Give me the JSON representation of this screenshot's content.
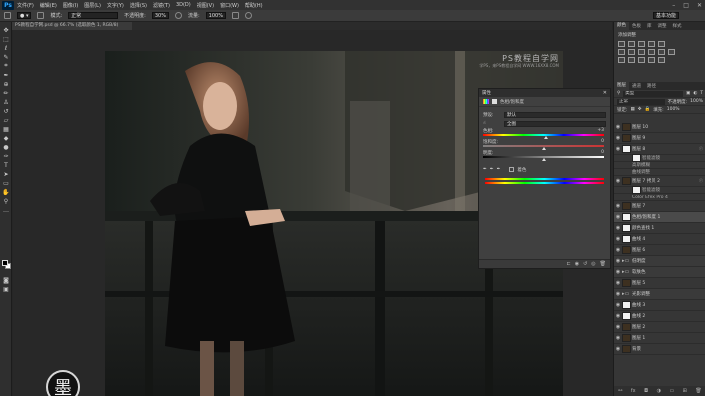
{
  "app": {
    "logo": "Ps",
    "menu": [
      "文件(F)",
      "编辑(E)",
      "图像(I)",
      "图层(L)",
      "文字(Y)",
      "选择(S)",
      "滤镜(T)",
      "3D(D)",
      "视图(V)",
      "窗口(W)",
      "帮助(H)"
    ],
    "window_controls": [
      "–",
      "□",
      "✕"
    ]
  },
  "options_bar": {
    "mode_label": "模式:",
    "mode_value": "正常",
    "opacity_label": "不透明度:",
    "opacity_value": "30%",
    "flow_label": "流量:",
    "flow_value": "100%",
    "workspace": "基本功能"
  },
  "document": {
    "tab_label": "PS教程自学网.psd @ 66.7% (选取颜色 1, RGB/8)"
  },
  "watermark": {
    "title": "PS教程自学网",
    "subtitle": "学PS，来PS教程自学网  WWW.16XX8.COM",
    "seal_char": "墨"
  },
  "properties": {
    "panel_tab": "属性",
    "close": "✕",
    "title": "色相/饱和度",
    "preset_label": "预设:",
    "preset_value": "默认",
    "channel_value": "全图",
    "sliders": [
      {
        "label": "色相:",
        "value": "+3",
        "fraction": 0.52
      },
      {
        "label": "饱和度:",
        "value": "0",
        "fraction": 0.5
      },
      {
        "label": "明度:",
        "value": "0",
        "fraction": 0.5
      }
    ],
    "colorize_label": "着色"
  },
  "right_panels": {
    "top_tabs": [
      "颜色",
      "色板",
      "库",
      "调整",
      "样式"
    ],
    "adjust_title": "添加调整",
    "layer_tabs": [
      "图层",
      "通道",
      "路径"
    ],
    "kind_label": "类型",
    "blend_mode": "正常",
    "opacity_label": "不透明度:",
    "opacity_value": "100%",
    "lock_label": "锁定:",
    "fill_label": "填充:",
    "fill_value": "100%",
    "layers": [
      {
        "name": "图层 10",
        "thumb": "photo",
        "visible": true,
        "type": "normal"
      },
      {
        "name": "图层 9",
        "thumb": "photo",
        "visible": true,
        "type": "normal"
      },
      {
        "name": "图层 8",
        "thumb": "white",
        "visible": true,
        "type": "normal",
        "fx": true
      },
      {
        "name": "智能滤镜",
        "thumb": "white",
        "visible": true,
        "type": "effect"
      },
      {
        "name": "高斯模糊",
        "thumb": "",
        "visible": true,
        "type": "effect"
      },
      {
        "name": "曲线调整",
        "thumb": "",
        "visible": true,
        "type": "effect"
      },
      {
        "name": "图层 7 拷贝 2",
        "thumb": "photo",
        "visible": true,
        "type": "normal",
        "fx": true
      },
      {
        "name": "智能滤镜",
        "thumb": "white",
        "visible": true,
        "type": "effect"
      },
      {
        "name": "Color Efex Pro 4",
        "thumb": "",
        "visible": true,
        "type": "effect"
      },
      {
        "name": "图层 7",
        "thumb": "photo",
        "visible": true,
        "type": "normal"
      },
      {
        "name": "色相/饱和度 1",
        "thumb": "white",
        "visible": true,
        "type": "normal",
        "selected": true
      },
      {
        "name": "颜色查找 1",
        "thumb": "white",
        "visible": true,
        "type": "normal"
      },
      {
        "name": "曲线 4",
        "thumb": "white",
        "visible": true,
        "type": "normal"
      },
      {
        "name": "图层 6",
        "thumb": "photo",
        "visible": true,
        "type": "normal"
      },
      {
        "name": "低明度",
        "thumb": "folder",
        "visible": true,
        "type": "group"
      },
      {
        "name": "软肤色",
        "thumb": "folder",
        "visible": true,
        "type": "group"
      },
      {
        "name": "图层 5",
        "thumb": "photo",
        "visible": true,
        "type": "normal"
      },
      {
        "name": "光影调整",
        "thumb": "folder",
        "visible": true,
        "type": "group"
      },
      {
        "name": "曲线 3",
        "thumb": "white",
        "visible": true,
        "type": "normal"
      },
      {
        "name": "曲线 2",
        "thumb": "white",
        "visible": true,
        "type": "normal"
      },
      {
        "name": "图层 2",
        "thumb": "photo",
        "visible": true,
        "type": "normal"
      },
      {
        "name": "图层 1",
        "thumb": "photo",
        "visible": true,
        "type": "normal"
      },
      {
        "name": "背景",
        "thumb": "photo",
        "visible": true,
        "type": "normal"
      }
    ]
  }
}
